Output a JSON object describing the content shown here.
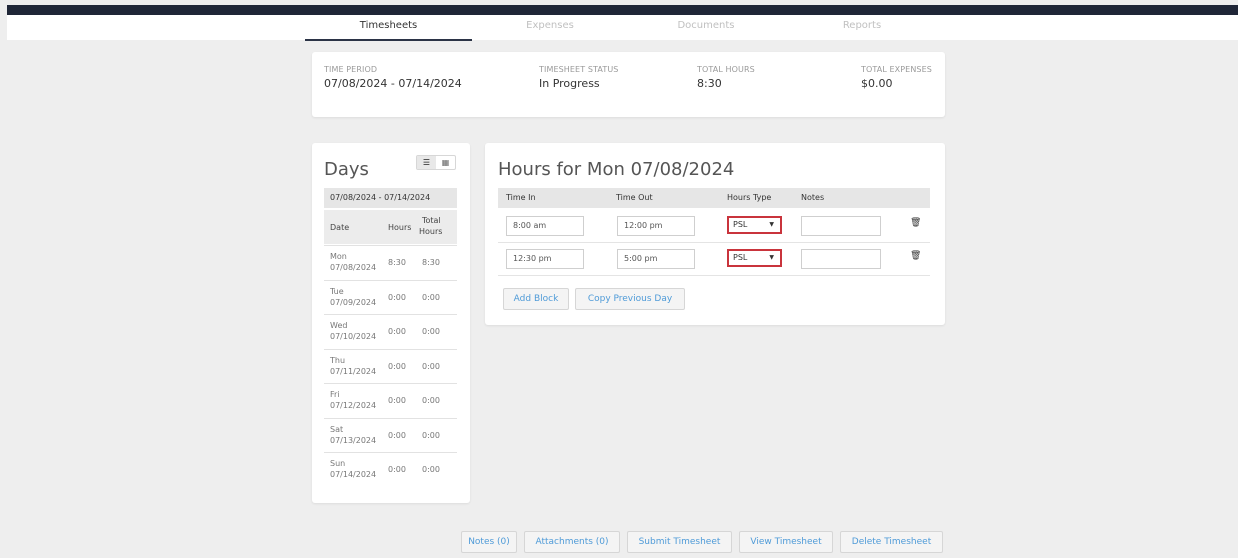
{
  "tabs": [
    "Timesheets",
    "Expenses",
    "Documents",
    "Reports"
  ],
  "summary": {
    "time_period_label": "TIME PERIOD",
    "time_period": "07/08/2024 - 07/14/2024",
    "status_label": "TIMESHEET STATUS",
    "status": "In Progress",
    "hours_label": "TOTAL HOURS",
    "hours": "8:30",
    "expenses_label": "TOTAL EXPENSES",
    "expenses": "$0.00"
  },
  "days": {
    "title": "Days",
    "range": "07/08/2024 - 07/14/2024",
    "col_date": "Date",
    "col_hours": "Hours",
    "col_total_1": "Total",
    "col_total_2": "Hours",
    "rows": [
      {
        "day": "Mon",
        "date": "07/08/2024",
        "hours": "8:30",
        "total": "8:30"
      },
      {
        "day": "Tue",
        "date": "07/09/2024",
        "hours": "0:00",
        "total": "0:00"
      },
      {
        "day": "Wed",
        "date": "07/10/2024",
        "hours": "0:00",
        "total": "0:00"
      },
      {
        "day": "Thu",
        "date": "07/11/2024",
        "hours": "0:00",
        "total": "0:00"
      },
      {
        "day": "Fri",
        "date": "07/12/2024",
        "hours": "0:00",
        "total": "0:00"
      },
      {
        "day": "Sat",
        "date": "07/13/2024",
        "hours": "0:00",
        "total": "0:00"
      },
      {
        "day": "Sun",
        "date": "07/14/2024",
        "hours": "0:00",
        "total": "0:00"
      }
    ]
  },
  "hours": {
    "title": "Hours for Mon 07/08/2024",
    "col_time_in": "Time In",
    "col_time_out": "Time Out",
    "col_hours_type": "Hours Type",
    "col_notes": "Notes",
    "blocks": [
      {
        "time_in": "8:00 am",
        "time_out": "12:00 pm",
        "type": "PSL",
        "notes": ""
      },
      {
        "time_in": "12:30 pm",
        "time_out": "5:00 pm",
        "type": "PSL",
        "notes": ""
      }
    ],
    "add_block": "Add Block",
    "copy_previous": "Copy Previous Day"
  },
  "actions": {
    "notes": "Notes (0)",
    "attachments": "Attachments (0)",
    "submit": "Submit Timesheet",
    "view": "View Timesheet",
    "delete": "Delete Timesheet"
  },
  "colors": {
    "topbar": "#1f2637",
    "link": "#4f9bd8",
    "highlight": "#c9343c"
  }
}
